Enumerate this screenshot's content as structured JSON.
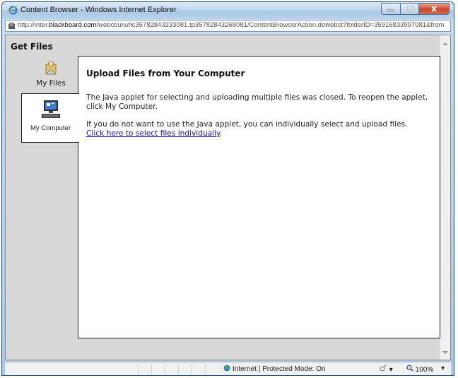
{
  "window": {
    "title": "Content Browser - Windows Internet Explorer",
    "url_prefix": "http://inter.",
    "url_domain": "blackboard.com",
    "url_rest": "/webct/urw/lc35782843233081.tp35782843268081/ContentBrowserAction.dowebct?folderID=35916833997081&from",
    "icons": [
      "ie-icon",
      "minimize-icon",
      "maximize-icon",
      "close-icon",
      "page-icon"
    ]
  },
  "sidebar": {
    "heading": "Get Files",
    "tabs": [
      {
        "label": "My Files",
        "icon": "user-folder-icon"
      },
      {
        "label": "My Computer",
        "icon": "computer-icon"
      }
    ]
  },
  "panel": {
    "title": "Upload Files from Your Computer",
    "message1": "The Java applet for selecting and uploading multiple files was closed. To reopen the applet, click My Computer.",
    "message2": "If you do not want to use the Java applet, you can individually select and upload files.",
    "link_text": "Click here to select files individually",
    "link_suffix": "."
  },
  "statusbar": {
    "zone": "Internet | Protected Mode: On",
    "zoom": "100%",
    "icons": [
      "globe-icon",
      "security-icon",
      "zoom-icon"
    ]
  },
  "colors": {
    "accent_link": "#1a0dab",
    "close_button": "#c8452c",
    "content_bg": "#d8d8d8"
  }
}
